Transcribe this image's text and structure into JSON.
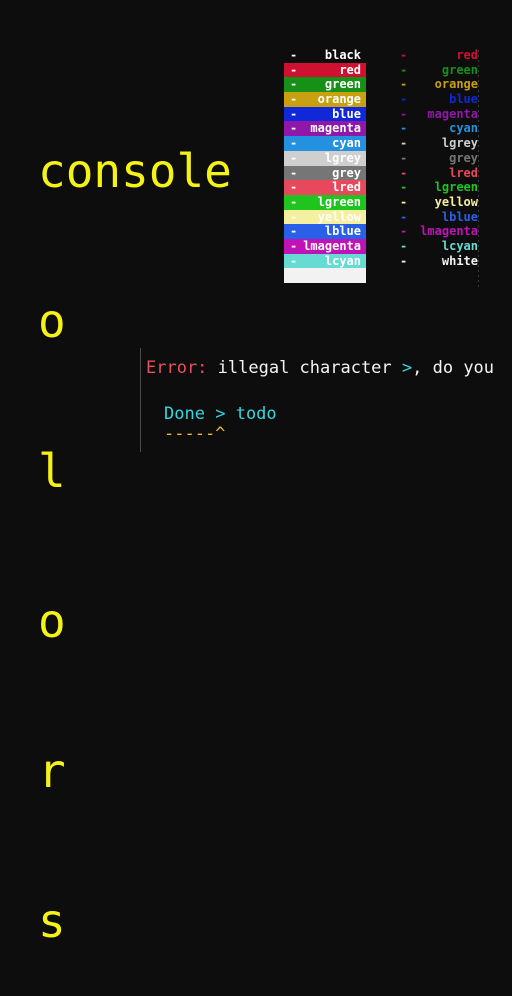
{
  "background_color": "#0d0d0d",
  "title": {
    "word": "console",
    "color": "#f5f215",
    "vertical_letters": [
      "o",
      "l",
      "o",
      "r",
      "s"
    ]
  },
  "swatch_table": {
    "dash": "-",
    "rows": [
      {
        "label": "black",
        "bg": "#0d0d0d",
        "fg": "#ffffff"
      },
      {
        "label": "red",
        "bg": "#d01030",
        "fg": "#ffffff"
      },
      {
        "label": "green",
        "bg": "#169016",
        "fg": "#ffffff"
      },
      {
        "label": "orange",
        "bg": "#c8a010",
        "fg": "#ffffff"
      },
      {
        "label": "blue",
        "bg": "#1028d8",
        "fg": "#ffffff"
      },
      {
        "label": "magenta",
        "bg": "#8f18a8",
        "fg": "#ffffff"
      },
      {
        "label": "cyan",
        "bg": "#2490e0",
        "fg": "#ffffff"
      },
      {
        "label": "lgrey",
        "bg": "#cfcfcf",
        "fg": "#ffffff"
      },
      {
        "label": "grey",
        "bg": "#767676",
        "fg": "#ffffff"
      },
      {
        "label": "lred",
        "bg": "#e8485b",
        "fg": "#ffffff"
      },
      {
        "label": "lgreen",
        "bg": "#1fc41f",
        "fg": "#ffffff"
      },
      {
        "label": "yellow",
        "bg": "#f5efa0",
        "fg": "#ffffff"
      },
      {
        "label": "lblue",
        "bg": "#2a60e8",
        "fg": "#ffffff"
      },
      {
        "label": "lmagenta",
        "bg": "#bf13b8",
        "fg": "#ffffff"
      },
      {
        "label": "lcyan",
        "bg": "#65dbd3",
        "fg": "#ffffff"
      },
      {
        "label": "",
        "bg": "#f2f2f2",
        "fg": "#ffffff"
      }
    ]
  },
  "legend": {
    "dash": "-",
    "rows": [
      {
        "label": "red",
        "color": "#d01030"
      },
      {
        "label": "green",
        "color": "#169016"
      },
      {
        "label": "orange",
        "color": "#c8a010"
      },
      {
        "label": "blue",
        "color": "#1028d8"
      },
      {
        "label": "magenta",
        "color": "#8f18a8"
      },
      {
        "label": "cyan",
        "color": "#2490e0"
      },
      {
        "label": "lgrey",
        "color": "#cfcfcf"
      },
      {
        "label": "grey",
        "color": "#767676"
      },
      {
        "label": "lred",
        "color": "#e8485b"
      },
      {
        "label": "lgreen",
        "color": "#1fc41f"
      },
      {
        "label": "yellow",
        "color": "#f5efa0"
      },
      {
        "label": "lblue",
        "color": "#2a60e8"
      },
      {
        "label": "lmagenta",
        "color": "#bf13b8"
      },
      {
        "label": "lcyan",
        "color": "#65dbd3"
      },
      {
        "label": "white",
        "color": "#f2f2f2"
      }
    ]
  },
  "console": {
    "error_label": "Error:",
    "error_message_a": " illegal character ",
    "error_symbol": ">",
    "error_message_b": ", do you",
    "done_word": "Done",
    "done_symbol": ">",
    "done_target": "todo",
    "caret_line": "-----^"
  }
}
